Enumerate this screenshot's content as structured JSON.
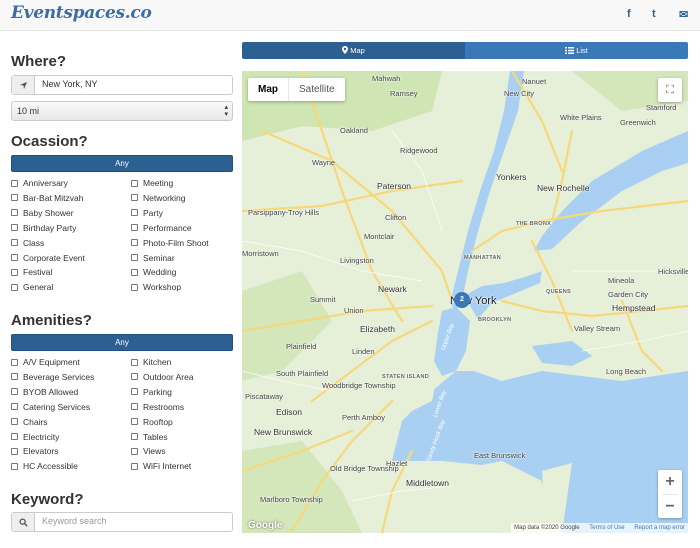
{
  "brand": {
    "logo_text": "Eventspaces.co"
  },
  "social": [
    {
      "name": "facebook-icon",
      "glyph": "f"
    },
    {
      "name": "twitter-icon",
      "glyph": "t"
    },
    {
      "name": "mail-icon",
      "glyph": "✉"
    }
  ],
  "sidebar": {
    "where_heading": "Where?",
    "location_value": "New York, NY",
    "radius_value": "10 mi",
    "occasion_heading": "Ocassion?",
    "occasion_any": "Any",
    "occasions_left": [
      "Anniversary",
      "Bar-Bat Mitzvah",
      "Baby Shower",
      "Birthday Party",
      "Class",
      "Corporate Event",
      "Festival",
      "General"
    ],
    "occasions_right": [
      "Meeting",
      "Networking",
      "Party",
      "Performance",
      "Photo-Film Shoot",
      "Seminar",
      "Wedding",
      "Workshop"
    ],
    "amenities_heading": "Amenities?",
    "amenities_any": "Any",
    "amenities_left": [
      "A/V Equipment",
      "Beverage Services",
      "BYOB Allowed",
      "Catering Services",
      "Chairs",
      "Electricity",
      "Elevators",
      "HC Accessible"
    ],
    "amenities_right": [
      "Kitchen",
      "Outdoor Area",
      "Parking",
      "Restrooms",
      "Rooftop",
      "Tables",
      "Views",
      "WiFi Internet"
    ],
    "keyword_heading": "Keyword?",
    "keyword_placeholder": "Keyword search"
  },
  "view_tabs": {
    "map_label": "Map",
    "list_label": "List"
  },
  "map": {
    "type_map": "Map",
    "type_satellite": "Satellite",
    "cluster_count": "2",
    "attribution": "Map data ©2020 Google",
    "terms": "Terms of Use",
    "report": "Report a map error",
    "google": "Google",
    "places": [
      {
        "t": "Mahwah",
        "c": ""
      },
      {
        "t": "Ramsey",
        "c": ""
      },
      {
        "t": "Nanuet",
        "c": ""
      },
      {
        "t": "New City",
        "c": ""
      },
      {
        "t": "Stamford",
        "c": ""
      },
      {
        "t": "Oakland",
        "c": ""
      },
      {
        "t": "White Plains",
        "c": ""
      },
      {
        "t": "Greenwich",
        "c": ""
      },
      {
        "t": "Ridgewood",
        "c": ""
      },
      {
        "t": "Wayne",
        "c": ""
      },
      {
        "t": "Paterson",
        "c": "big"
      },
      {
        "t": "Yonkers",
        "c": "big"
      },
      {
        "t": "New Rochelle",
        "c": "big"
      },
      {
        "t": "Parsippany-Troy Hills",
        "c": ""
      },
      {
        "t": "Clifton",
        "c": ""
      },
      {
        "t": "THE BRONX",
        "c": "caps"
      },
      {
        "t": "Montclair",
        "c": ""
      },
      {
        "t": "Morristown",
        "c": ""
      },
      {
        "t": "Livingston",
        "c": ""
      },
      {
        "t": "MANHATTAN",
        "c": "caps"
      },
      {
        "t": "Mineola",
        "c": ""
      },
      {
        "t": "Hicksville",
        "c": ""
      },
      {
        "t": "Newark",
        "c": "big"
      },
      {
        "t": "QUEENS",
        "c": "caps"
      },
      {
        "t": "Garden City",
        "c": ""
      },
      {
        "t": "Summit",
        "c": ""
      },
      {
        "t": "Union",
        "c": ""
      },
      {
        "t": "Hempstead",
        "c": "big"
      },
      {
        "t": "New York",
        "c": "ny"
      },
      {
        "t": "BROOKLYN",
        "c": "caps"
      },
      {
        "t": "Elizabeth",
        "c": "big"
      },
      {
        "t": "Valley Stream",
        "c": ""
      },
      {
        "t": "Plainfield",
        "c": ""
      },
      {
        "t": "Linden",
        "c": ""
      },
      {
        "t": "Upper Bay",
        "c": "water"
      },
      {
        "t": "Long Beach",
        "c": ""
      },
      {
        "t": "South Plainfield",
        "c": ""
      },
      {
        "t": "STATEN ISLAND",
        "c": "caps"
      },
      {
        "t": "Piscataway",
        "c": ""
      },
      {
        "t": "Woodbridge Township",
        "c": ""
      },
      {
        "t": "Edison",
        "c": "big"
      },
      {
        "t": "Lower Bay",
        "c": "water"
      },
      {
        "t": "Perth Amboy",
        "c": ""
      },
      {
        "t": "New Brunswick",
        "c": "big"
      },
      {
        "t": "Sandy Hook Bay",
        "c": "water"
      },
      {
        "t": "Hazlet",
        "c": ""
      },
      {
        "t": "East Brunswick",
        "c": ""
      },
      {
        "t": "Old Bridge Township",
        "c": ""
      },
      {
        "t": "Middletown",
        "c": "big"
      },
      {
        "t": "Marlboro Township",
        "c": ""
      }
    ]
  }
}
